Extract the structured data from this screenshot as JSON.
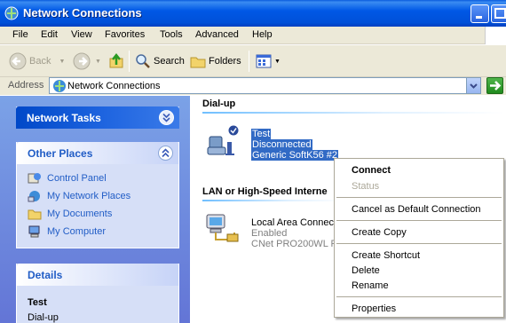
{
  "window": {
    "title": "Network Connections"
  },
  "menubar": {
    "items": [
      "File",
      "Edit",
      "View",
      "Favorites",
      "Tools",
      "Advanced",
      "Help"
    ]
  },
  "toolbar": {
    "back": "Back",
    "search": "Search",
    "folders": "Folders"
  },
  "address": {
    "label": "Address",
    "value": "Network Connections"
  },
  "sidebar": {
    "network_tasks": {
      "title": "Network Tasks"
    },
    "other_places": {
      "title": "Other Places",
      "links": [
        "Control Panel",
        "My Network Places",
        "My Documents",
        "My Computer"
      ]
    },
    "details": {
      "title": "Details",
      "name": "Test",
      "type": "Dial-up"
    }
  },
  "main": {
    "dialup": {
      "header": "Dial-up",
      "item": {
        "name": "Test",
        "status": "Disconnected",
        "device": "Generic SoftK56 #2"
      }
    },
    "lan": {
      "header": "LAN or High-Speed Interne",
      "item": {
        "name": "Local Area Connect",
        "status": "Enabled",
        "device": "CNet PRO200WL P"
      }
    }
  },
  "context_menu": {
    "connect": "Connect",
    "status": "Status",
    "cancel_default": "Cancel as Default Connection",
    "create_copy": "Create Copy",
    "create_shortcut": "Create Shortcut",
    "delete": "Delete",
    "rename": "Rename",
    "properties": "Properties"
  },
  "colors": {
    "accent": "#316ac5",
    "titlebar": "#0058e6",
    "sidebar": "#6375d6"
  }
}
